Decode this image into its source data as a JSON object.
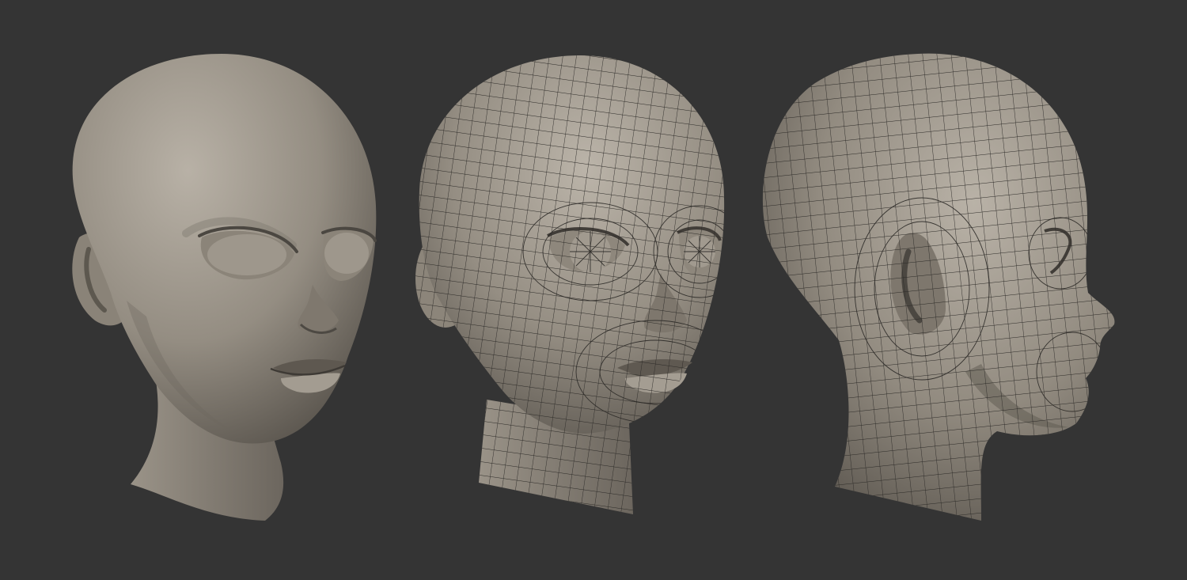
{
  "scene": {
    "background_color": "#343434",
    "clay_light": "#b3aca1",
    "clay_mid": "#8f887d",
    "clay_dark": "#5a554e",
    "wire_color": "#2c2a27",
    "views": [
      {
        "name": "smooth-front-three-quarter",
        "style": "smooth"
      },
      {
        "name": "wireframe-front-three-quarter",
        "style": "wireframe"
      },
      {
        "name": "wireframe-side-profile",
        "style": "wireframe"
      }
    ]
  }
}
